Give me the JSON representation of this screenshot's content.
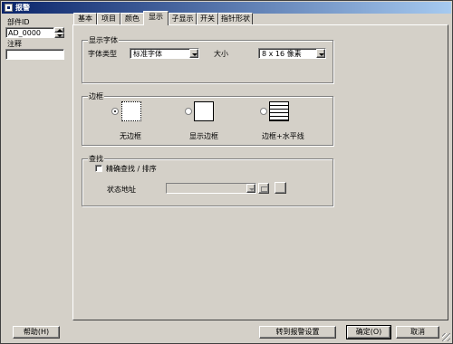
{
  "window": {
    "title": "报警"
  },
  "left": {
    "part_id_label": "部件ID",
    "part_id_value": "AD_0000",
    "comment_label": "注释",
    "comment_value": ""
  },
  "tabs": [
    {
      "label": "基本"
    },
    {
      "label": "项目"
    },
    {
      "label": "颜色"
    },
    {
      "label": "显示"
    },
    {
      "label": "子显示"
    },
    {
      "label": "开关"
    },
    {
      "label": "指针形状"
    }
  ],
  "active_tab": "显示",
  "font_group": {
    "title": "显示字体",
    "type_label": "字体类型",
    "type_value": "标准字体",
    "size_label": "大小",
    "size_value": "8 x 16  像素"
  },
  "border_group": {
    "title": "边框",
    "options": [
      {
        "label": "无边框",
        "selected": true,
        "icon": "no-border-icon"
      },
      {
        "label": "显示边框",
        "selected": false,
        "icon": "border-icon"
      },
      {
        "label": "边框+水平线",
        "selected": false,
        "icon": "border-lines-icon"
      }
    ]
  },
  "search_group": {
    "title": "查找",
    "exact_label": "精确查找 / 排序",
    "exact_checked": false,
    "address_label": "状态地址",
    "address_value": ""
  },
  "footer": {
    "help": "帮助(H)",
    "goto": "转到报警设置",
    "ok": "确定(O)",
    "cancel": "取消"
  }
}
